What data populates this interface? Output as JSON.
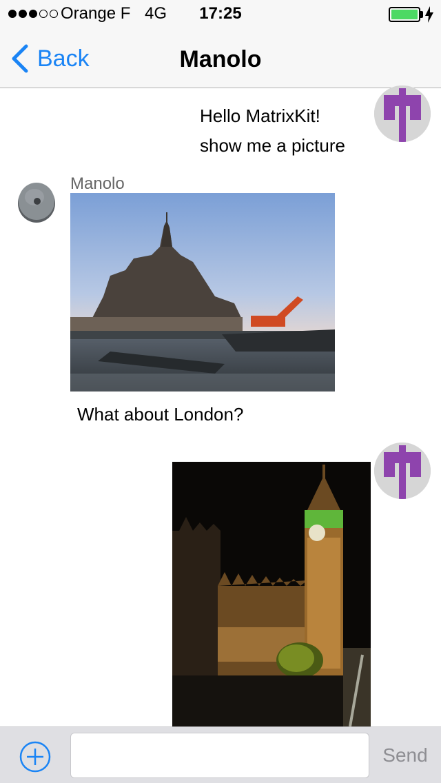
{
  "status_bar": {
    "signal_dots": "●●●○○",
    "carrier": "Orange F",
    "network": "4G",
    "time": "17:25",
    "battery_level": 1.0,
    "battery_color": "#4cd964",
    "charging_icon": "bolt-icon"
  },
  "nav": {
    "back_label": "Back",
    "back_icon": "chevron-left-icon",
    "title": "Manolo",
    "accent_color": "#1a84f5"
  },
  "messages": [
    {
      "sender": "me",
      "kind": "text",
      "lines": [
        "Hello MatrixKit!",
        "show me a picture"
      ],
      "avatar": "matrix-identicon-avatar"
    },
    {
      "sender": "Manolo",
      "kind": "image",
      "image": "mont-saint-michel-photo",
      "avatar": "millstone-avatar"
    },
    {
      "sender": "Manolo",
      "kind": "text",
      "lines": [
        "What about London?"
      ]
    },
    {
      "sender": "me",
      "kind": "image",
      "image": "big-ben-night-photo",
      "avatar": "matrix-identicon-avatar"
    }
  ],
  "composer": {
    "attach_icon": "plus-circle-icon",
    "input_value": "",
    "input_placeholder": "",
    "send_label": "Send"
  }
}
